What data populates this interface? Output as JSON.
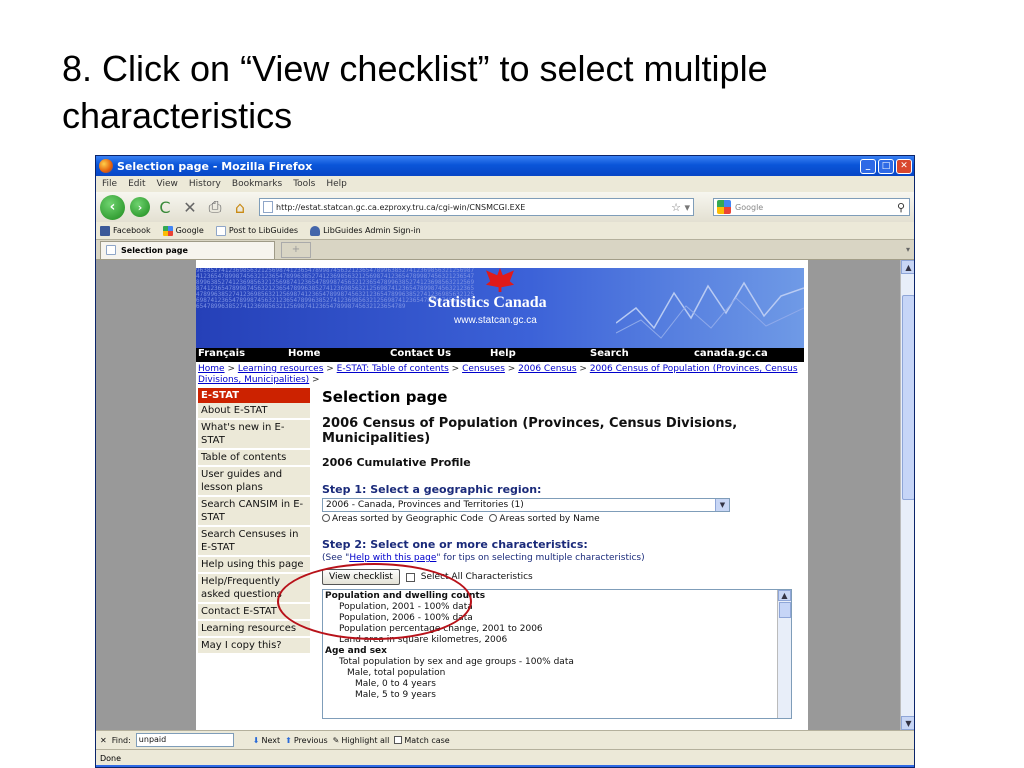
{
  "slide": {
    "title": "8. Click on “View checklist” to select multiple characteristics"
  },
  "window": {
    "title": "Selection page - Mozilla Firefox",
    "buttons": {
      "minimize": "_",
      "maximize": "□",
      "close": "✕"
    }
  },
  "menu": {
    "items": [
      "File",
      "Edit",
      "View",
      "History",
      "Bookmarks",
      "Tools",
      "Help"
    ]
  },
  "toolbar": {
    "back": "‹",
    "forward": "›",
    "reload": "C",
    "stop": "✕",
    "print": "⎙",
    "home": "⌂",
    "url": "http://estat.statcan.gc.ca.ezproxy.tru.ca/cgi-win/CNSMCGI.EXE",
    "search_placeholder": "Google"
  },
  "bookmarks": [
    {
      "label": "Facebook",
      "icon": "facebook-icon",
      "color": "#3b5998"
    },
    {
      "label": "Google",
      "icon": "google-icon",
      "color": "#4285f4"
    },
    {
      "label": "Post to LibGuides",
      "icon": "page-icon",
      "color": "#ffffff"
    },
    {
      "label": "LibGuides Admin Sign-in",
      "icon": "bookmark-icon",
      "color": "#4466aa"
    }
  ],
  "tab": {
    "label": "Selection page",
    "add": "+"
  },
  "banner": {
    "title": "Statistics Canada",
    "url": "www.statcan.gc.ca"
  },
  "topnav": [
    "Français",
    "Home",
    "Contact Us",
    "Help",
    "Search",
    "canada.gc.ca"
  ],
  "breadcrumb": {
    "home": "Home",
    "sep": " > ",
    "learning": "Learning resources",
    "estat": "E-STAT: Table of contents",
    "censuses": "Censuses",
    "census2006": "2006 Census",
    "population": "2006 Census of Population (Provinces, Census Divisions, Municipalities)",
    "trail_end": " >"
  },
  "leftnav": {
    "header": "E-STAT",
    "items": [
      "About E-STAT",
      "What's new in E-STAT",
      "Table of contents",
      "User guides and lesson plans",
      "Search CANSIM in E-STAT",
      "Search Censuses in E-STAT",
      "Help using this page",
      "Help/Frequently asked questions",
      "Contact E-STAT",
      "Learning resources",
      "May I copy this?"
    ]
  },
  "main": {
    "heading": "Selection page",
    "census_title": "2006 Census of Population (Provinces, Census Divisions, Municipalities)",
    "profile": "2006 Cumulative Profile",
    "step1": "Step 1: Select a geographic region:",
    "region_value": "2006 - Canada, Provinces and Territories (1)",
    "radio1": "Areas sorted by Geographic Code",
    "radio2": "Areas sorted by Name",
    "step2": "Step 2: Select one or more characteristics:",
    "tips_pre": "(See \"",
    "tips_link": "Help with this page",
    "tips_post": "\" for tips on selecting multiple characteristics)",
    "view_checklist": "View checklist",
    "select_all": "Select All Characteristics",
    "list": [
      {
        "text": "Population and dwelling counts",
        "level": 0
      },
      {
        "text": "Population, 2001 - 100% data",
        "level": 1
      },
      {
        "text": "Population, 2006 - 100% data",
        "level": 1
      },
      {
        "text": "Population percentage change, 2001 to 2006",
        "level": 1
      },
      {
        "text": "Land area in square kilometres, 2006",
        "level": 1
      },
      {
        "text": "Age and sex",
        "level": 0
      },
      {
        "text": "Total population by sex and age groups - 100% data",
        "level": 1
      },
      {
        "text": "Male, total population",
        "level": 2
      },
      {
        "text": "Male, 0 to 4 years",
        "level": 3
      },
      {
        "text": "Male, 5 to 9 years",
        "level": 3
      }
    ]
  },
  "findbar": {
    "close": "✕",
    "label": "Find:",
    "value": "unpaid",
    "next": "Next",
    "previous": "Previous",
    "highlight": "Highlight all",
    "match_case": "Match case"
  },
  "status": "Done",
  "colors": {
    "annotation": "#b8121a",
    "estat_header": "#cc2200",
    "banner": "#2540b8"
  }
}
